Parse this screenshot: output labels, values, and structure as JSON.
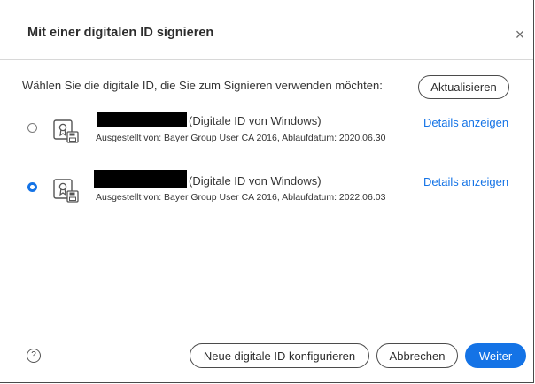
{
  "dialog": {
    "title": "Mit einer digitalen ID signieren",
    "close_glyph": "×",
    "instruction": "Wählen Sie die digitale ID, die Sie zum Signieren verwenden möchten:",
    "refresh_label": "Aktualisieren"
  },
  "ids": [
    {
      "label": "(Digitale ID von Windows)",
      "issued": "Ausgestellt von: Bayer Group User CA 2016, Ablaufdatum: 2020.06.30",
      "details_label": "Details anzeigen",
      "selected": false
    },
    {
      "label": "(Digitale ID von Windows)",
      "issued": "Ausgestellt von: Bayer Group User CA 2016, Ablaufdatum: 2022.06.03",
      "details_label": "Details anzeigen",
      "selected": true
    }
  ],
  "footer": {
    "help_glyph": "?",
    "new_id_label": "Neue digitale ID konfigurieren",
    "cancel_label": "Abbrechen",
    "next_label": "Weiter"
  },
  "colors": {
    "accent": "#1473e6",
    "redaction": "#000000"
  }
}
